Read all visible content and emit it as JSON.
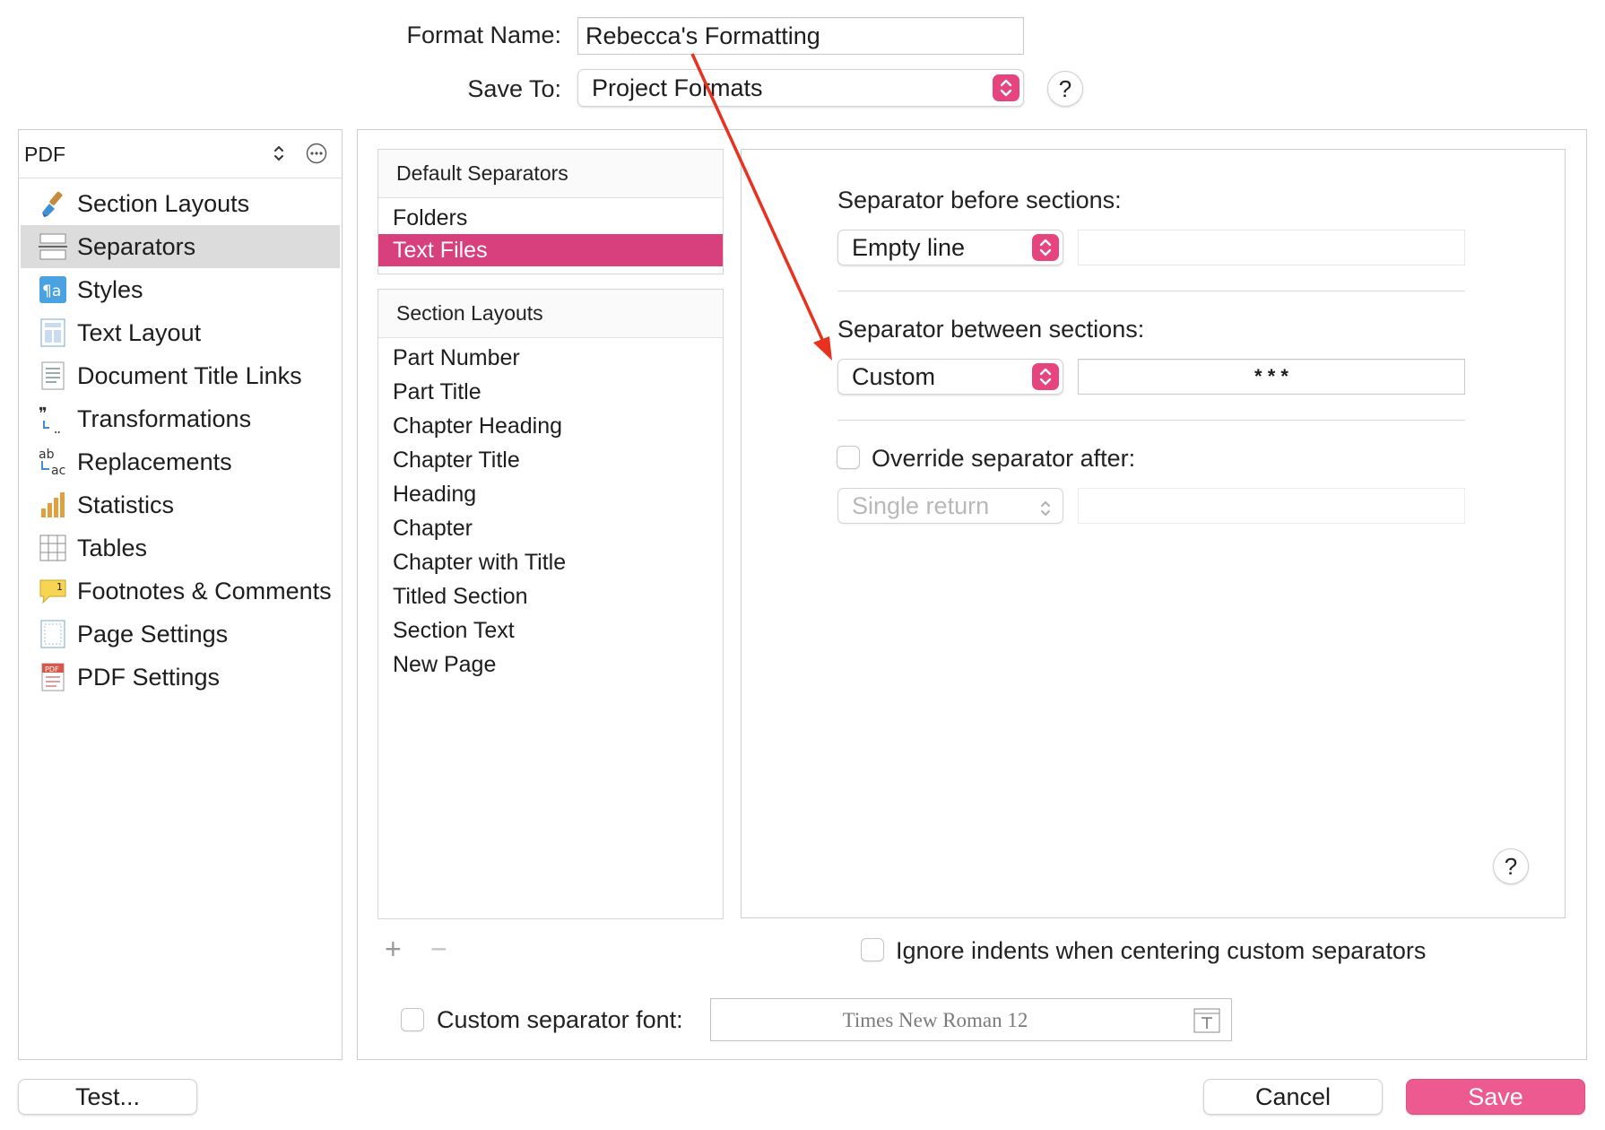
{
  "header": {
    "format_name_label": "Format Name:",
    "format_name_value": "Rebecca's Formatting",
    "save_to_label": "Save To:",
    "save_to_value": "Project Formats",
    "help": "?"
  },
  "sidebar": {
    "format_select": "PDF",
    "items": [
      {
        "label": "Section Layouts",
        "icon": "brush-icon"
      },
      {
        "label": "Separators",
        "icon": "separators-icon",
        "selected": true
      },
      {
        "label": "Styles",
        "icon": "styles-icon"
      },
      {
        "label": "Text Layout",
        "icon": "text-layout-icon"
      },
      {
        "label": "Document Title Links",
        "icon": "document-icon"
      },
      {
        "label": "Transformations",
        "icon": "quotes-icon"
      },
      {
        "label": "Replacements",
        "icon": "replacements-icon"
      },
      {
        "label": "Statistics",
        "icon": "bar-chart-icon"
      },
      {
        "label": "Tables",
        "icon": "table-icon"
      },
      {
        "label": "Footnotes & Comments",
        "icon": "footnote-icon"
      },
      {
        "label": "Page Settings",
        "icon": "page-icon"
      },
      {
        "label": "PDF Settings",
        "icon": "pdf-icon"
      }
    ]
  },
  "separators_list": {
    "default_header": "Default Separators",
    "default_items": [
      "Folders",
      "Text Files"
    ],
    "selected_default": "Text Files",
    "layouts_header": "Section Layouts",
    "layout_items": [
      "Part Number",
      "Part Title",
      "Chapter Heading",
      "Chapter Title",
      "Heading",
      "Chapter",
      "Chapter with Title",
      "Titled Section",
      "Section Text",
      "New Page"
    ],
    "add": "+",
    "remove": "−"
  },
  "settings": {
    "before_label": "Separator before sections:",
    "before_value": "Empty line",
    "before_text": "",
    "between_label": "Separator between sections:",
    "between_value": "Custom",
    "between_text": "* * *",
    "override_label": "Override separator after:",
    "override_value": "Single return",
    "override_text": "",
    "help": "?",
    "ignore_indents_label": "Ignore indents when centering custom separators",
    "custom_font_label": "Custom separator font:",
    "custom_font_value": "Times New Roman 12"
  },
  "buttons": {
    "test": "Test...",
    "cancel": "Cancel",
    "save": "Save"
  },
  "colors": {
    "accent": "#d83f7d",
    "save": "#ec5a8f",
    "annotation_arrow": "#e8321f"
  }
}
